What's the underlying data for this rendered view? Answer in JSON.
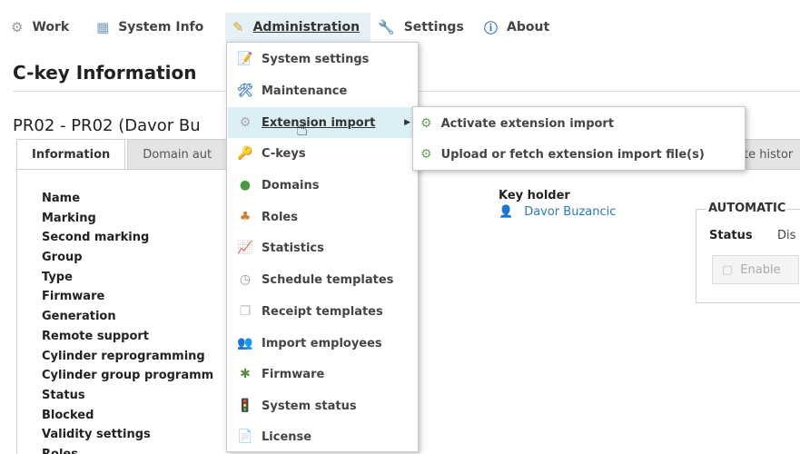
{
  "nav": {
    "items": [
      {
        "label": "Work",
        "icon": "gear-icon"
      },
      {
        "label": "System Info",
        "icon": "grid-icon"
      },
      {
        "label": "Administration",
        "icon": "pencil-icon"
      },
      {
        "label": "Settings",
        "icon": "wrench-icon"
      },
      {
        "label": "About",
        "icon": "info-icon"
      }
    ]
  },
  "page": {
    "title": "C-key Information",
    "subtitle": "PR02 - PR02 (Davor Bu"
  },
  "tabs": {
    "information": "Information",
    "domain_auth": "Domain aut",
    "history": "te histor"
  },
  "fields": [
    "Name",
    "Marking",
    "Second marking",
    "Group",
    "Type",
    "Firmware",
    "Generation",
    "Remote support",
    "Cylinder reprogramming",
    "Cylinder group programm",
    "Status",
    "Blocked",
    "Validity settings",
    "Roles"
  ],
  "keyholder": {
    "label": "Key holder",
    "value": "Davor Buzancic"
  },
  "automatic": {
    "legend": "AUTOMATIC",
    "status_label": "Status",
    "status_value": "Dis",
    "enable_label": "Enable"
  },
  "admin_menu": [
    {
      "label": "System settings",
      "icon": "settings-doc-icon"
    },
    {
      "label": "Maintenance",
      "icon": "maintenance-icon"
    },
    {
      "label": "Extension import",
      "icon": "import-icon"
    },
    {
      "label": "C-keys",
      "icon": "key-icon"
    },
    {
      "label": "Domains",
      "icon": "globe-icon"
    },
    {
      "label": "Roles",
      "icon": "roles-icon"
    },
    {
      "label": "Statistics",
      "icon": "chart-icon"
    },
    {
      "label": "Schedule templates",
      "icon": "clock-icon"
    },
    {
      "label": "Receipt templates",
      "icon": "receipt-icon"
    },
    {
      "label": "Import employees",
      "icon": "employees-icon"
    },
    {
      "label": "Firmware",
      "icon": "chip-icon"
    },
    {
      "label": "System status",
      "icon": "traffic-light-icon"
    },
    {
      "label": "License",
      "icon": "license-icon"
    }
  ],
  "submenu": [
    {
      "label": "Activate extension import",
      "icon": "activate-icon"
    },
    {
      "label": "Upload or fetch extension import file(s)",
      "icon": "upload-icon"
    }
  ],
  "colors": {
    "accent_link": "#2a7ab0",
    "hover_bg": "#dceef6"
  }
}
